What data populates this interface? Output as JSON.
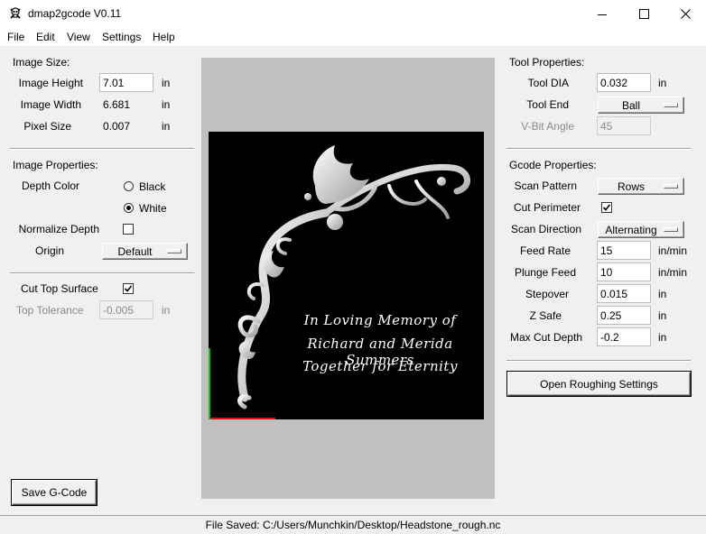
{
  "window": {
    "title": "dmap2gcode V0.11",
    "icon": "skull-crossbones-icon",
    "controls": [
      "minimize-icon",
      "maximize-icon",
      "close-icon"
    ]
  },
  "menu": [
    "File",
    "Edit",
    "View",
    "Settings",
    "Help"
  ],
  "image_size": {
    "section_label": "Image Size:",
    "height_label": "Image Height",
    "height_value": "7.01",
    "height_unit": "in",
    "width_label": "Image Width",
    "width_value": "6.681",
    "width_unit": "in",
    "pixel_label": "Pixel Size",
    "pixel_value": "0.007",
    "pixel_unit": "in"
  },
  "image_properties": {
    "section_label": "Image Properties:",
    "depth_color_label": "Depth Color",
    "option_black": "Black",
    "option_white": "White",
    "selected_depth_color": "White",
    "normalize_label": "Normalize Depth",
    "normalize_checked": false,
    "origin_label": "Origin",
    "origin_value": "Default"
  },
  "top_surface": {
    "cut_top_label": "Cut Top Surface",
    "cut_top_checked": true,
    "tolerance_label": "Top Tolerance",
    "tolerance_value": "-0.005",
    "tolerance_unit": "in"
  },
  "save_button": "Save G-Code",
  "preview": {
    "engraving_lines": [
      "In Loving Memory of",
      "Richard and Merida Summers",
      "Together for Eternity"
    ],
    "axis_colors": {
      "x": "#e01010",
      "y": "#10c010"
    }
  },
  "tool_properties": {
    "section_label": "Tool Properties:",
    "dia_label": "Tool DIA",
    "dia_value": "0.032",
    "dia_unit": "in",
    "end_label": "Tool End",
    "end_value": "Ball",
    "vbit_label": "V-Bit Angle",
    "vbit_value": "45"
  },
  "gcode_properties": {
    "section_label": "Gcode Properties:",
    "scan_pattern_label": "Scan Pattern",
    "scan_pattern_value": "Rows",
    "cut_perimeter_label": "Cut Perimeter",
    "cut_perimeter_checked": true,
    "scan_direction_label": "Scan Direction",
    "scan_direction_value": "Alternating",
    "feed_rate_label": "Feed Rate",
    "feed_rate_value": "15",
    "feed_rate_unit": "in/min",
    "plunge_feed_label": "Plunge Feed",
    "plunge_feed_value": "10",
    "plunge_feed_unit": "in/min",
    "stepover_label": "Stepover",
    "stepover_value": "0.015",
    "stepover_unit": "in",
    "zsafe_label": "Z Safe",
    "zsafe_value": "0.25",
    "zsafe_unit": "in",
    "max_cut_label": "Max Cut Depth",
    "max_cut_value": "-0.2",
    "max_cut_unit": "in"
  },
  "roughing_button": "Open Roughing Settings",
  "status": "File Saved: C:/Users/Munchkin/Desktop/Headstone_rough.nc"
}
